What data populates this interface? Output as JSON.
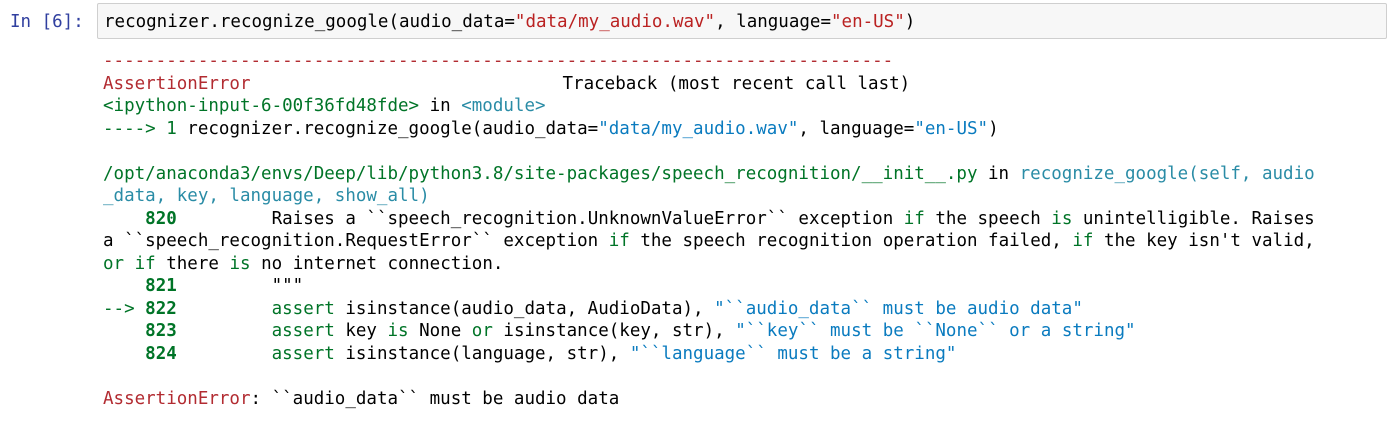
{
  "cell": {
    "prompt": "In [6]:",
    "input": {
      "prefix": "recognizer.recognize_google(audio_data=",
      "arg1": "\"data/my_audio.wav\"",
      "mid": ", language=",
      "arg2": "\"en-US\"",
      "suffix": ")"
    }
  },
  "traceback": {
    "separator": "---------------------------------------------------------------------------",
    "error_name": "AssertionError",
    "header_right": "Traceback (most recent call last)",
    "frame1": {
      "location": "<ipython-input-6-00f36fd48fde>",
      "in_word": " in ",
      "module": "<module>",
      "arrow": "----> 1 ",
      "code_prefix": "recognizer",
      "code_dot": ".",
      "code_rest": "recognize_google(audio_data=",
      "code_arg1": "\"data/my_audio.wav\"",
      "code_mid": ", language=",
      "code_arg2": "\"en-US\"",
      "code_end": ")"
    },
    "frame2": {
      "path": "/opt/anaconda3/envs/Deep/lib/python3.8/site-packages/speech_recognition/__init__.py",
      "in_word": " in ",
      "func_line1": "recognize_google(self, audio",
      "func_line2": "_data, key, language, show_all)",
      "lines": [
        {
          "arrow": "    ",
          "num": "820",
          "text1": "         Raises a ``speech_recognition",
          "dot": ".",
          "text2": "UnknownValueError`` exception ",
          "kw_if": "if",
          "text3": " the speech ",
          "kw_is": "is",
          "text4": " unintelligible",
          "dot2": ".",
          "text5": " Raises"
        }
      ],
      "line820_cont1": {
        "a": "a ``speech_recognition",
        "dot": ".",
        "b": "RequestError`` exception ",
        "kw_if": "if",
        "c": " the speech recognition operation failed, ",
        "kw_if2": "if",
        "d": " the key isn't valid,"
      },
      "line820_cont2": {
        "kw_or": "or",
        "sp1": " ",
        "kw_if": "if",
        "a": " there ",
        "kw_is": "is",
        "b": " no internet connection",
        "dot": "."
      },
      "line821": {
        "arrow": "    ",
        "num": "821",
        "text": "         \"\"\""
      },
      "line822": {
        "arrow": "--> ",
        "num": "822",
        "pad": "         ",
        "kw": "assert",
        "a": " isinstance(audio_data, AudioData), ",
        "str": "\"``audio_data`` must be audio data\""
      },
      "line823": {
        "arrow": "    ",
        "num": "823",
        "pad": "         ",
        "kw": "assert",
        "a": " key ",
        "kw_is": "is",
        "b": " None ",
        "kw_or": "or",
        "c": " isinstance(key, str), ",
        "str": "\"``key`` must be ``None`` or a string\""
      },
      "line824": {
        "arrow": "    ",
        "num": "824",
        "pad": "         ",
        "kw": "assert",
        "a": " isinstance(language, str), ",
        "str": "\"``language`` must be a string\""
      }
    },
    "final": {
      "error_name": "AssertionError",
      "message": ": ``audio_data`` must be audio data"
    }
  },
  "colors": {
    "prompt": "#303f9f",
    "error": "#b22b31",
    "lineno": "#007427",
    "link": "#0065ca",
    "string": "#0a7bbf"
  }
}
